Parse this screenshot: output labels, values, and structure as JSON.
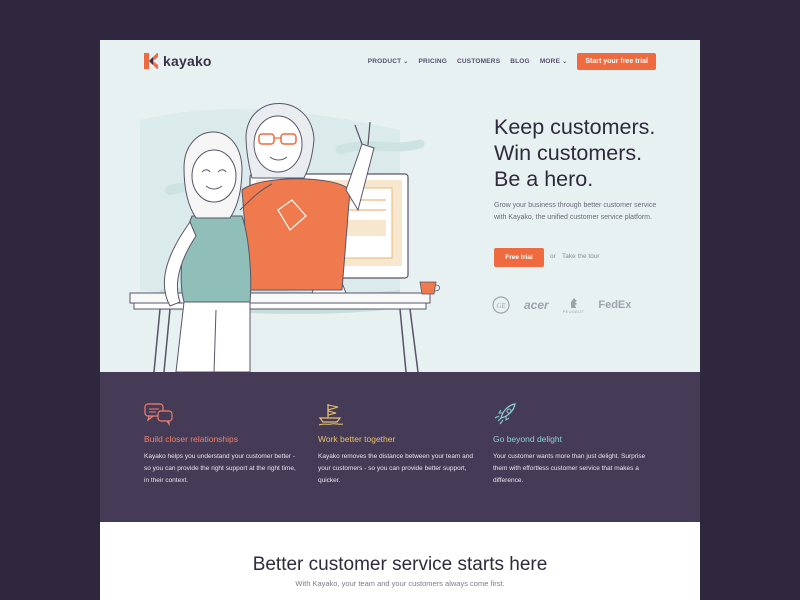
{
  "brand": {
    "name": "kayako",
    "accent": "#ef6a3e",
    "dark": "#463b56"
  },
  "nav": {
    "items": [
      {
        "label": "PRODUCT",
        "has_dropdown": true
      },
      {
        "label": "PRICING",
        "has_dropdown": false
      },
      {
        "label": "CUSTOMERS",
        "has_dropdown": false
      },
      {
        "label": "BLOG",
        "has_dropdown": false
      },
      {
        "label": "MORE",
        "has_dropdown": true
      }
    ],
    "cta": "Start your free trial"
  },
  "hero": {
    "headline": [
      "Keep customers.",
      "Win customers.",
      "Be a hero."
    ],
    "subtext": "Grow your business through better customer service with Kayako, the unified customer service platform.",
    "primary_button": "Free trial",
    "or_text": "or",
    "secondary_link": "Take the tour",
    "logos": [
      "GE",
      "acer",
      "PEUGEOT",
      "FedEx"
    ]
  },
  "features": [
    {
      "icon": "chat-bubbles-icon",
      "title": "Build closer relationships",
      "color": "#f0806a",
      "desc": "Kayako helps you understand your customer better - so you can provide the right support at the right time, in their context."
    },
    {
      "icon": "ship-icon",
      "title": "Work better together",
      "color": "#e7c06b",
      "desc": "Kayako removes the distance between your team and your customers - so you can provide better support, quicker."
    },
    {
      "icon": "rocket-icon",
      "title": "Go beyond delight",
      "color": "#8fd0d2",
      "desc": "Your customer wants more than just delight. Surprise them with effortless customer service that makes a difference."
    }
  ],
  "bottom": {
    "title": "Better customer service starts here",
    "subtitle": "With Kayako, your team and your customers always come first."
  }
}
